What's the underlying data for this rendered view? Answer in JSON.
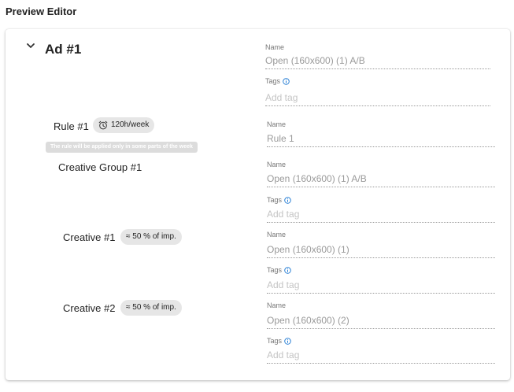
{
  "page_title": "Preview Editor",
  "colors": {
    "info": "#1976d2",
    "chip_bg": "#e6e6e6",
    "hint_bg": "#dcdcdc"
  },
  "ad": {
    "title": "Ad #1",
    "name_label": "Name",
    "name_value": "Open (160x600) (1) A/B",
    "tags_label": "Tags",
    "tags_placeholder": "Add tag"
  },
  "rule": {
    "label": "Rule #1",
    "chip": "120h/week",
    "hint": "The rule will be applied only in some parts of the week",
    "name_label": "Name",
    "name_value": "Rule 1"
  },
  "creative_group": {
    "label": "Creative Group #1",
    "name_label": "Name",
    "name_value": "Open (160x600) (1) A/B",
    "tags_label": "Tags",
    "tags_placeholder": "Add tag"
  },
  "creatives": [
    {
      "label": "Creative #1",
      "chip": "≈ 50 % of imp.",
      "name_label": "Name",
      "name_value": "Open (160x600) (1)",
      "tags_label": "Tags",
      "tags_placeholder": "Add tag"
    },
    {
      "label": "Creative #2",
      "chip": "≈ 50 % of imp.",
      "name_label": "Name",
      "name_value": "Open (160x600) (2)",
      "tags_label": "Tags",
      "tags_placeholder": "Add tag"
    }
  ]
}
